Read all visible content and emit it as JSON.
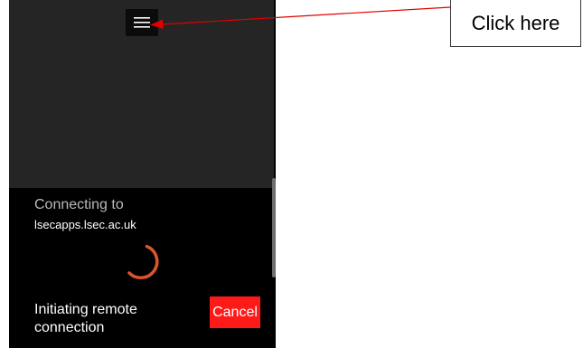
{
  "connection": {
    "connecting_label": "Connecting to",
    "host": "lsecapps.lsec.ac.uk",
    "status": "Initiating remote connection",
    "cancel_label": "Cancel"
  },
  "annotation": {
    "callout_text": "Click here",
    "arrow_color": "#e00000"
  },
  "icons": {
    "menu": "hamburger-menu-icon",
    "spinner": "loading-spinner-icon"
  },
  "colors": {
    "top_background": "#252525",
    "bottom_background": "#000000",
    "cancel_button": "#ff1a1a",
    "spinner": "#d9552b"
  }
}
